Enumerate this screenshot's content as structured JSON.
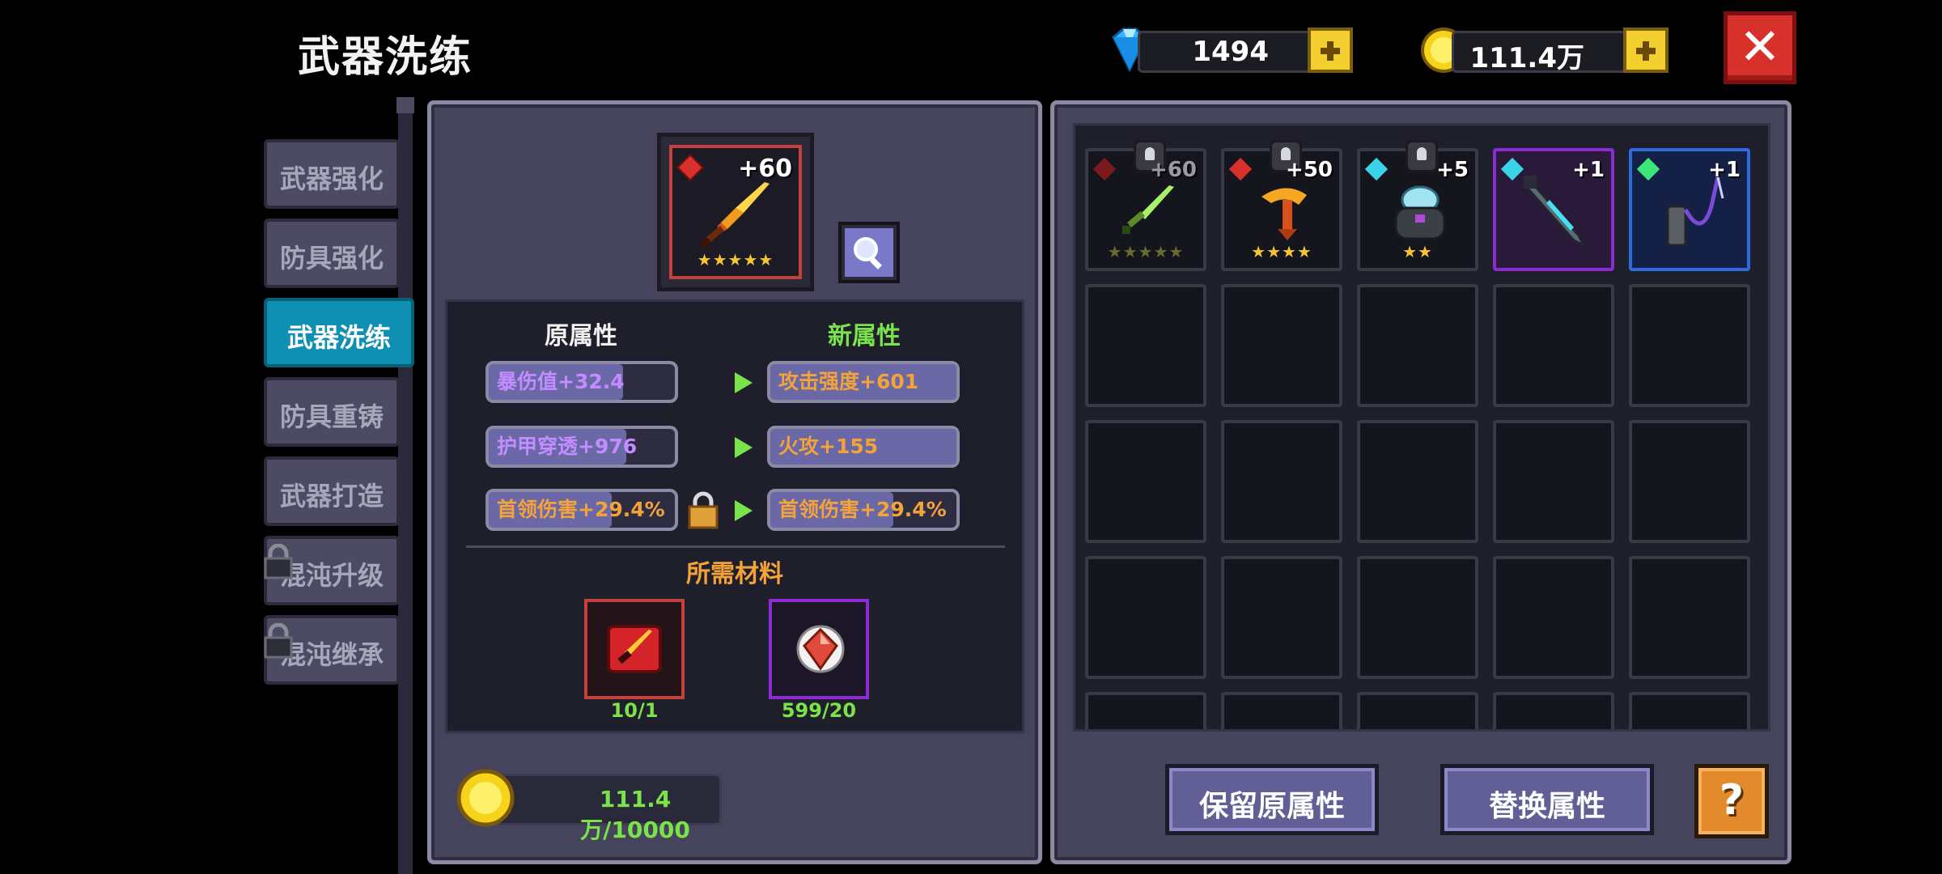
{
  "header": {
    "title": "武器洗练",
    "diamonds": "1494",
    "gold": "111.4万"
  },
  "tabs": [
    {
      "label": "武器强化",
      "active": false,
      "locked": false
    },
    {
      "label": "防具强化",
      "active": false,
      "locked": false
    },
    {
      "label": "武器洗练",
      "active": true,
      "locked": false
    },
    {
      "label": "防具重铸",
      "active": false,
      "locked": false
    },
    {
      "label": "武器打造",
      "active": false,
      "locked": false
    },
    {
      "label": "混沌升级",
      "active": false,
      "locked": true
    },
    {
      "label": "混沌继承",
      "active": false,
      "locked": true
    }
  ],
  "selected_weapon": {
    "level": "+60",
    "stars": "★★★★★"
  },
  "attributes": {
    "old_header": "原属性",
    "new_header": "新属性",
    "old": [
      "暴伤值+32.4",
      "护甲穿透+976",
      "首领伤害+29.4%"
    ],
    "new": [
      "攻击强度+601",
      "火攻+155",
      "首领伤害+29.4%"
    ],
    "third_locked": true
  },
  "materials": {
    "header": "所需材料",
    "items": [
      {
        "name": "sword-scroll",
        "count": "10/1"
      },
      {
        "name": "red-gem",
        "count": "599/20"
      }
    ]
  },
  "cost": {
    "text": "111.4万/10000"
  },
  "inventory": [
    {
      "level": "+60",
      "stars": "★★★★★",
      "frame": "red",
      "gem": "red",
      "bell": true
    },
    {
      "level": "+50",
      "stars": "★★★★",
      "frame": "red",
      "gem": "red",
      "bell": true
    },
    {
      "level": "+5",
      "stars": "★★",
      "frame": "red",
      "gem": "cyan",
      "bell": true
    },
    {
      "level": "+1",
      "stars": "",
      "frame": "purple",
      "gem": "cyan",
      "bell": false
    },
    {
      "level": "+1",
      "stars": "",
      "frame": "blue",
      "gem": "green",
      "bell": false
    }
  ],
  "buttons": {
    "keep": "保留原属性",
    "replace": "替换属性",
    "help": "?"
  },
  "colors": {
    "accent_green": "#7be34a",
    "gold_text": "#f3a33a",
    "attr_purple": "#c38cff",
    "attr_orange": "#f3a33a"
  }
}
